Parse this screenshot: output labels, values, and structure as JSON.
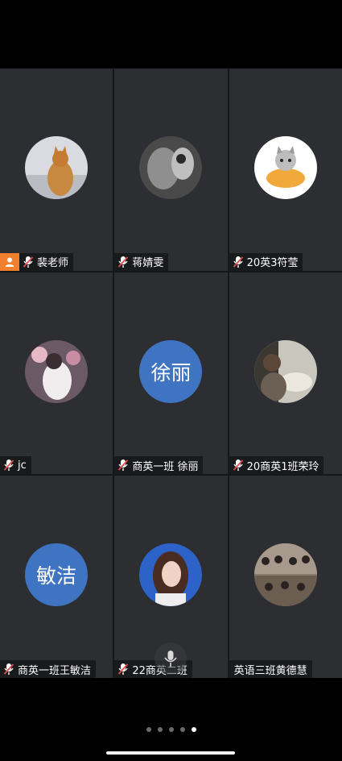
{
  "participants": [
    {
      "name": "裴老师",
      "host": true,
      "avatar_type": "photo",
      "avatar_desc": "cat photo"
    },
    {
      "name": "蒋婧雯",
      "host": false,
      "avatar_type": "photo",
      "avatar_desc": "monochrome cat"
    },
    {
      "name": "20英3符莹",
      "host": false,
      "avatar_type": "photo",
      "avatar_desc": "cat in cake"
    },
    {
      "name": "jc",
      "host": false,
      "avatar_type": "photo",
      "avatar_desc": "person with flowers"
    },
    {
      "name": "商英一班 徐丽",
      "host": false,
      "avatar_type": "text",
      "avatar_text": "徐丽"
    },
    {
      "name": "20商英1班荣玲",
      "host": false,
      "avatar_type": "photo",
      "avatar_desc": "person with cat"
    },
    {
      "name": "商英一班王敏洁",
      "host": false,
      "avatar_type": "text",
      "avatar_text": "敏洁"
    },
    {
      "name": "22商英二班",
      "host": false,
      "avatar_type": "photo",
      "avatar_desc": "portrait"
    },
    {
      "name": "英语三班黄德慧",
      "host": false,
      "avatar_type": "photo",
      "avatar_desc": "group photo"
    }
  ],
  "pagination": {
    "total": 5,
    "current": 5
  },
  "colors": {
    "host_badge": "#f07f2e",
    "text_avatar": "#3f74c2",
    "mic_muted": "#e24b4b"
  },
  "icons": {
    "host": "person-icon",
    "mic": "mic-muted-icon"
  }
}
